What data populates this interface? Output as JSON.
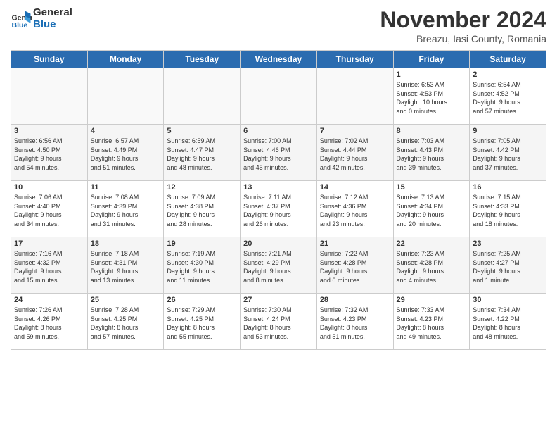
{
  "logo": {
    "line1": "General",
    "line2": "Blue"
  },
  "title": "November 2024",
  "subtitle": "Breazu, Iasi County, Romania",
  "days_header": [
    "Sunday",
    "Monday",
    "Tuesday",
    "Wednesday",
    "Thursday",
    "Friday",
    "Saturday"
  ],
  "weeks": [
    [
      {
        "day": "",
        "info": ""
      },
      {
        "day": "",
        "info": ""
      },
      {
        "day": "",
        "info": ""
      },
      {
        "day": "",
        "info": ""
      },
      {
        "day": "",
        "info": ""
      },
      {
        "day": "1",
        "info": "Sunrise: 6:53 AM\nSunset: 4:53 PM\nDaylight: 10 hours\nand 0 minutes."
      },
      {
        "day": "2",
        "info": "Sunrise: 6:54 AM\nSunset: 4:52 PM\nDaylight: 9 hours\nand 57 minutes."
      }
    ],
    [
      {
        "day": "3",
        "info": "Sunrise: 6:56 AM\nSunset: 4:50 PM\nDaylight: 9 hours\nand 54 minutes."
      },
      {
        "day": "4",
        "info": "Sunrise: 6:57 AM\nSunset: 4:49 PM\nDaylight: 9 hours\nand 51 minutes."
      },
      {
        "day": "5",
        "info": "Sunrise: 6:59 AM\nSunset: 4:47 PM\nDaylight: 9 hours\nand 48 minutes."
      },
      {
        "day": "6",
        "info": "Sunrise: 7:00 AM\nSunset: 4:46 PM\nDaylight: 9 hours\nand 45 minutes."
      },
      {
        "day": "7",
        "info": "Sunrise: 7:02 AM\nSunset: 4:44 PM\nDaylight: 9 hours\nand 42 minutes."
      },
      {
        "day": "8",
        "info": "Sunrise: 7:03 AM\nSunset: 4:43 PM\nDaylight: 9 hours\nand 39 minutes."
      },
      {
        "day": "9",
        "info": "Sunrise: 7:05 AM\nSunset: 4:42 PM\nDaylight: 9 hours\nand 37 minutes."
      }
    ],
    [
      {
        "day": "10",
        "info": "Sunrise: 7:06 AM\nSunset: 4:40 PM\nDaylight: 9 hours\nand 34 minutes."
      },
      {
        "day": "11",
        "info": "Sunrise: 7:08 AM\nSunset: 4:39 PM\nDaylight: 9 hours\nand 31 minutes."
      },
      {
        "day": "12",
        "info": "Sunrise: 7:09 AM\nSunset: 4:38 PM\nDaylight: 9 hours\nand 28 minutes."
      },
      {
        "day": "13",
        "info": "Sunrise: 7:11 AM\nSunset: 4:37 PM\nDaylight: 9 hours\nand 26 minutes."
      },
      {
        "day": "14",
        "info": "Sunrise: 7:12 AM\nSunset: 4:36 PM\nDaylight: 9 hours\nand 23 minutes."
      },
      {
        "day": "15",
        "info": "Sunrise: 7:13 AM\nSunset: 4:34 PM\nDaylight: 9 hours\nand 20 minutes."
      },
      {
        "day": "16",
        "info": "Sunrise: 7:15 AM\nSunset: 4:33 PM\nDaylight: 9 hours\nand 18 minutes."
      }
    ],
    [
      {
        "day": "17",
        "info": "Sunrise: 7:16 AM\nSunset: 4:32 PM\nDaylight: 9 hours\nand 15 minutes."
      },
      {
        "day": "18",
        "info": "Sunrise: 7:18 AM\nSunset: 4:31 PM\nDaylight: 9 hours\nand 13 minutes."
      },
      {
        "day": "19",
        "info": "Sunrise: 7:19 AM\nSunset: 4:30 PM\nDaylight: 9 hours\nand 11 minutes."
      },
      {
        "day": "20",
        "info": "Sunrise: 7:21 AM\nSunset: 4:29 PM\nDaylight: 9 hours\nand 8 minutes."
      },
      {
        "day": "21",
        "info": "Sunrise: 7:22 AM\nSunset: 4:28 PM\nDaylight: 9 hours\nand 6 minutes."
      },
      {
        "day": "22",
        "info": "Sunrise: 7:23 AM\nSunset: 4:28 PM\nDaylight: 9 hours\nand 4 minutes."
      },
      {
        "day": "23",
        "info": "Sunrise: 7:25 AM\nSunset: 4:27 PM\nDaylight: 9 hours\nand 1 minute."
      }
    ],
    [
      {
        "day": "24",
        "info": "Sunrise: 7:26 AM\nSunset: 4:26 PM\nDaylight: 8 hours\nand 59 minutes."
      },
      {
        "day": "25",
        "info": "Sunrise: 7:28 AM\nSunset: 4:25 PM\nDaylight: 8 hours\nand 57 minutes."
      },
      {
        "day": "26",
        "info": "Sunrise: 7:29 AM\nSunset: 4:25 PM\nDaylight: 8 hours\nand 55 minutes."
      },
      {
        "day": "27",
        "info": "Sunrise: 7:30 AM\nSunset: 4:24 PM\nDaylight: 8 hours\nand 53 minutes."
      },
      {
        "day": "28",
        "info": "Sunrise: 7:32 AM\nSunset: 4:23 PM\nDaylight: 8 hours\nand 51 minutes."
      },
      {
        "day": "29",
        "info": "Sunrise: 7:33 AM\nSunset: 4:23 PM\nDaylight: 8 hours\nand 49 minutes."
      },
      {
        "day": "30",
        "info": "Sunrise: 7:34 AM\nSunset: 4:22 PM\nDaylight: 8 hours\nand 48 minutes."
      }
    ]
  ]
}
